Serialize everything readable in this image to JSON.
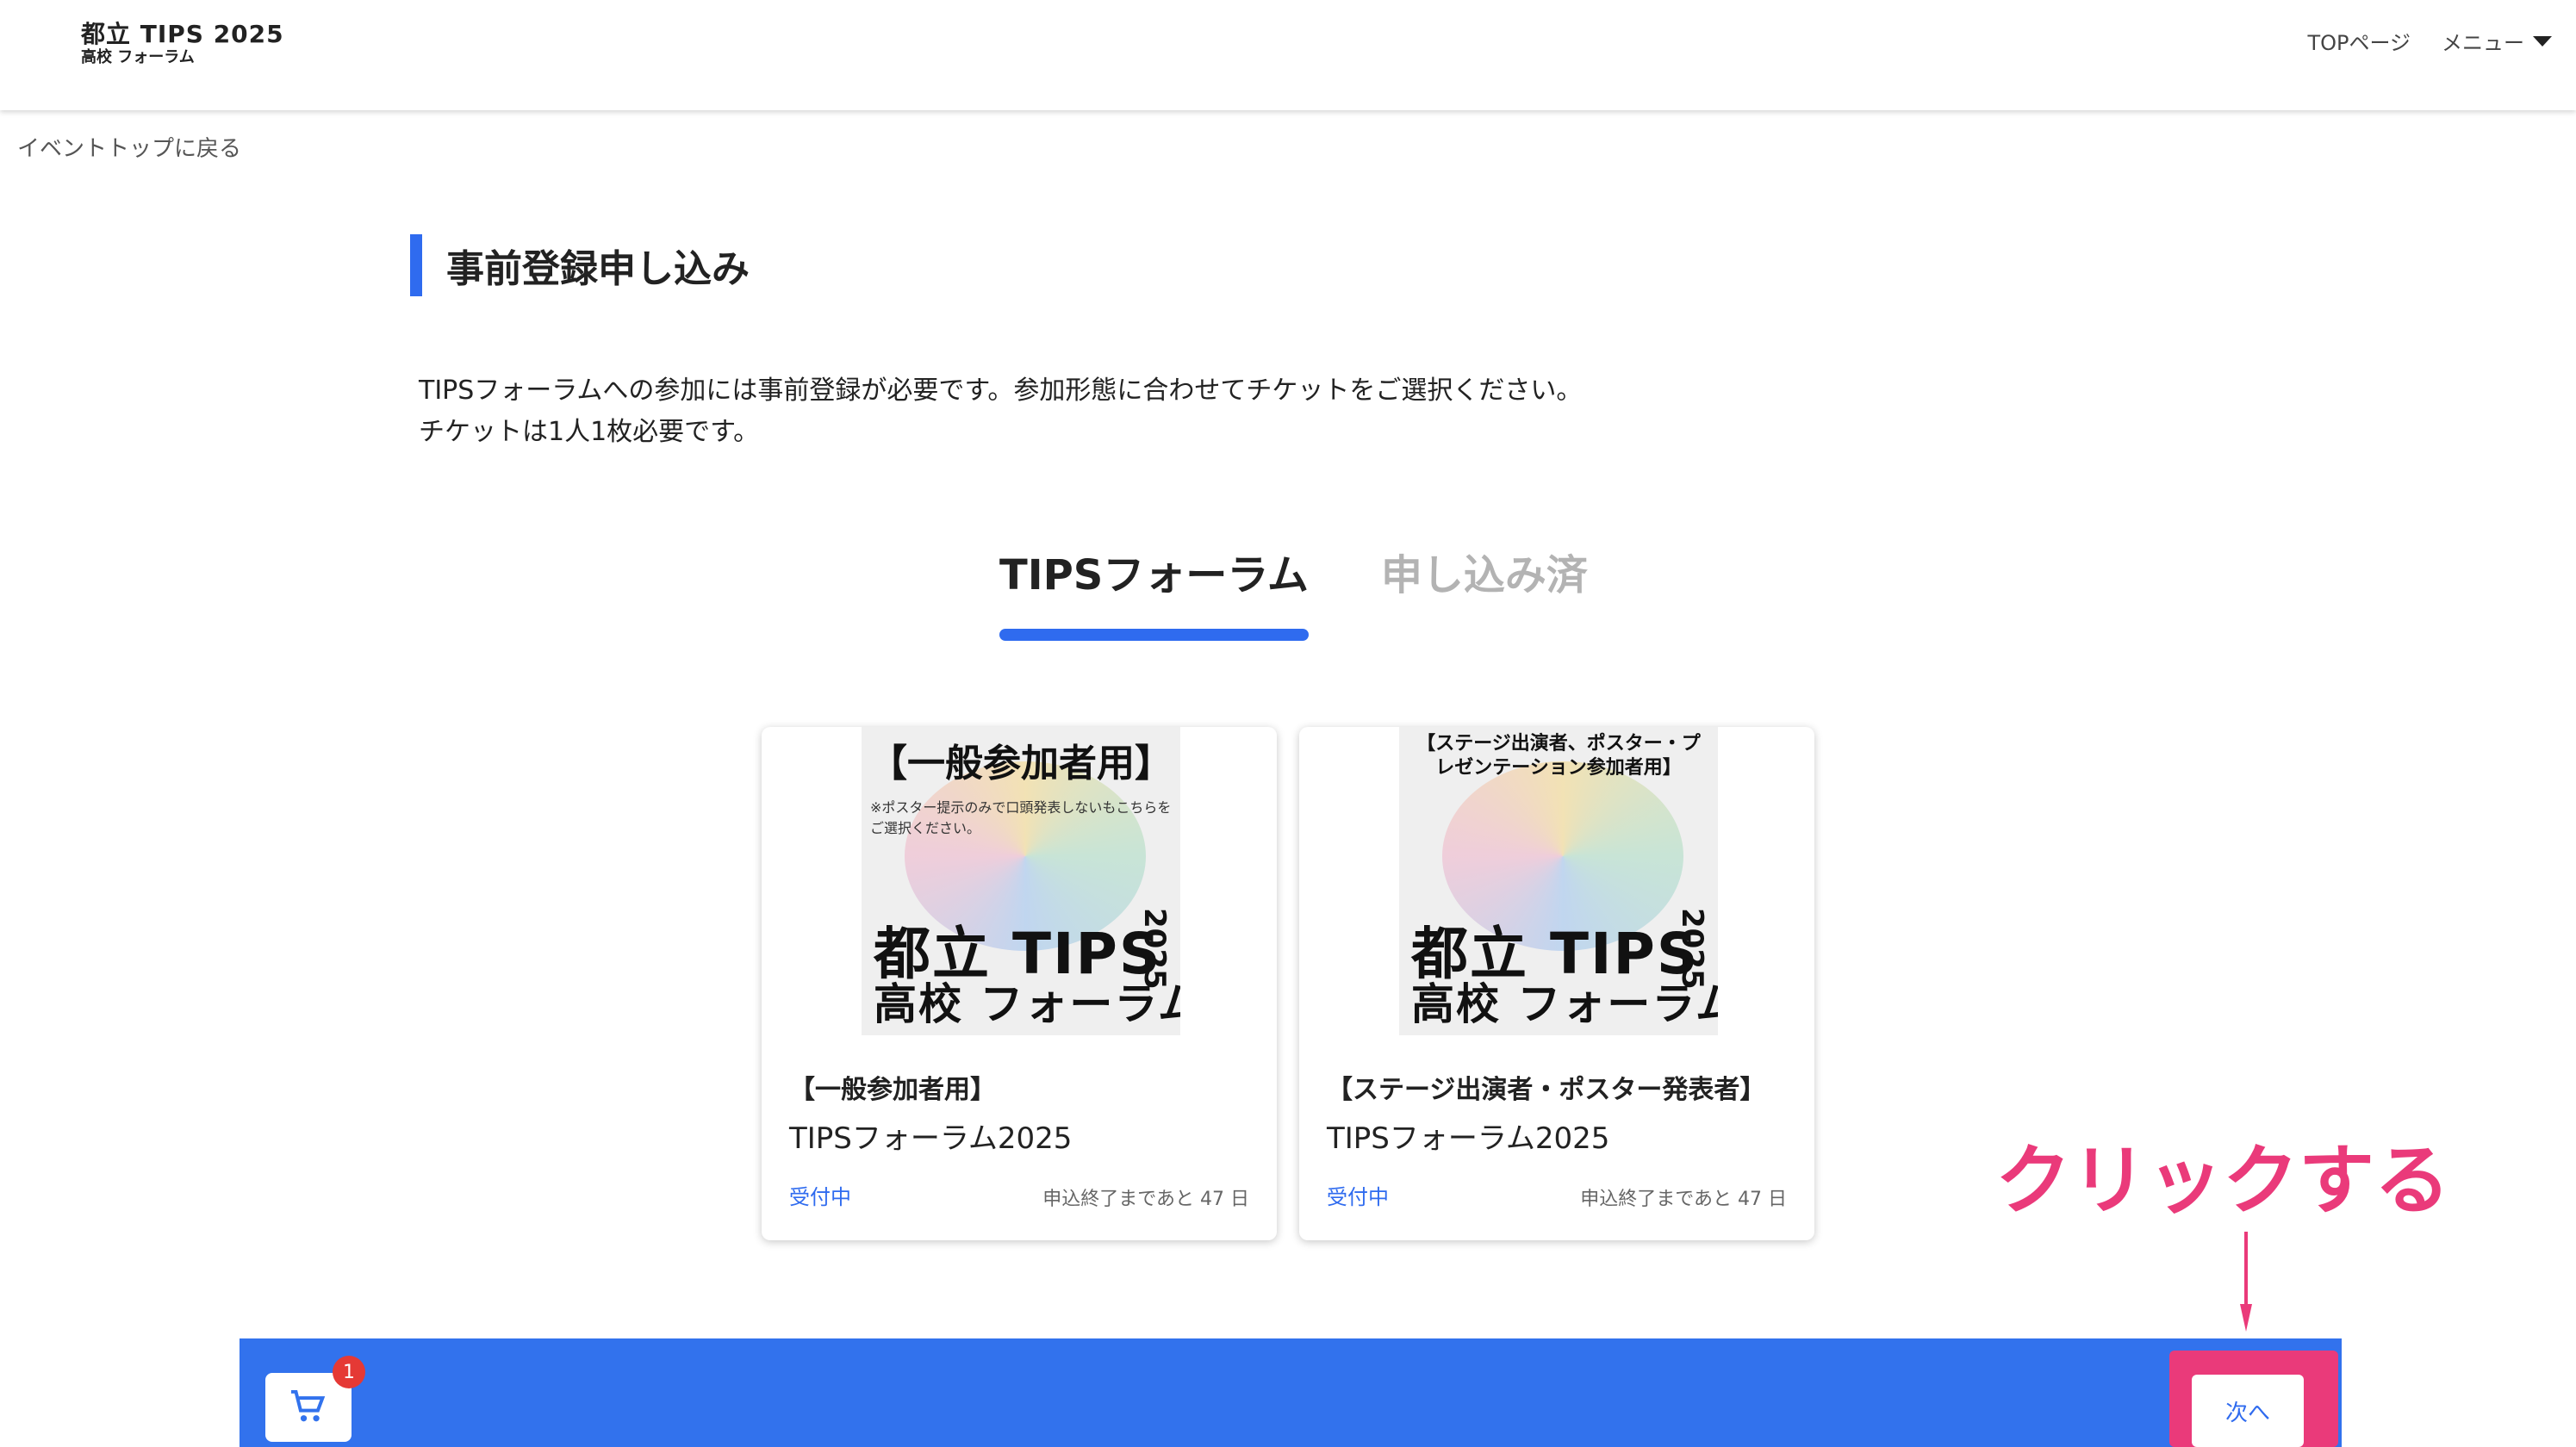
{
  "header": {
    "logo_line1": "都立 TIPS 2025",
    "logo_line2": "高校 フォーラム",
    "nav_top": "TOPページ",
    "nav_menu": "メニュー"
  },
  "back_link": "イベントトップに戻る",
  "section_title": "事前登録申し込み",
  "intro": {
    "line1": "TIPSフォーラムへの参加には事前登録が必要です。参加形態に合わせてチケットをご選択ください。",
    "line2": "チケットは1人1枚必要です。"
  },
  "tabs": [
    {
      "label": "TIPSフォーラム",
      "active": true
    },
    {
      "label": "申し込み済",
      "active": false
    }
  ],
  "cards": [
    {
      "thumb_caption": "【一般参加者用】",
      "thumb_note": "※ポスター提示のみで口頭発表しないもこちらをご選択ください。",
      "thumb_big1": "都立 TIPS",
      "thumb_big2": "高校 フォーラム",
      "thumb_year": "2025",
      "tag": "【一般参加者用】",
      "name": "TIPSフォーラム2025",
      "status": "受付中",
      "deadline": "申込終了まであと 47 日"
    },
    {
      "thumb_caption": "【ステージ出演者、ポスター・プレゼンテーション参加者用】",
      "thumb_note": "",
      "thumb_big1": "都立 TIPS",
      "thumb_big2": "高校 フォーラム",
      "thumb_year": "2025",
      "tag": "【ステージ出演者・ポスター発表者】",
      "name": "TIPSフォーラム2025",
      "status": "受付中",
      "deadline": "申込終了まであと 47 日"
    }
  ],
  "cart": {
    "badge_count": "1",
    "icon": "cart-icon"
  },
  "next_button": "次へ",
  "annotation": "クリックする",
  "colors": {
    "accent": "#2f6bef",
    "bar": "#3272ed",
    "highlight": "#ea3a7a",
    "badge": "#e53935"
  }
}
